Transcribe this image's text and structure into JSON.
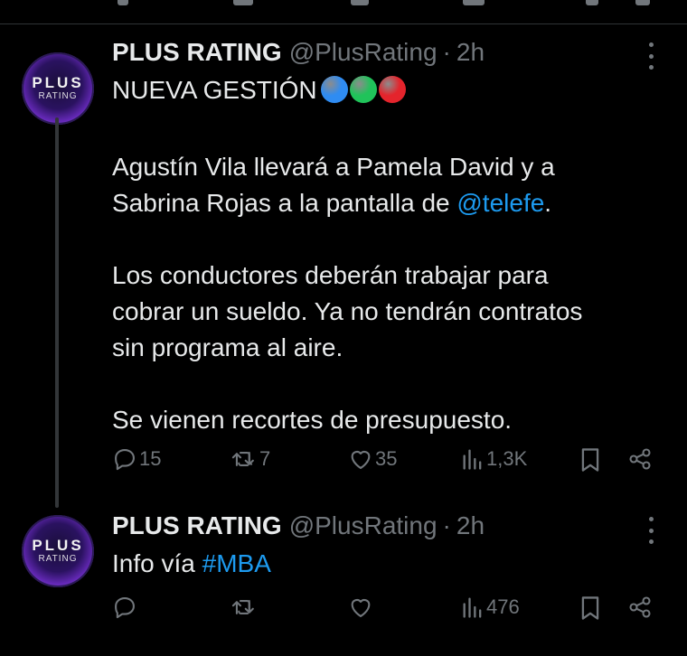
{
  "tweets": [
    {
      "avatar": {
        "line1": "PLUS",
        "line2": "RATING"
      },
      "name": "PLUS RATING",
      "handle": "@PlusRating",
      "separator": "·",
      "time": "2h",
      "text": {
        "line1": "NUEVA GESTIÓN",
        "line1_circle_colors": [
          "#2f8cf2",
          "#20c35a",
          "#e4242c"
        ],
        "p1_before": "Agustín Vila llevará a Pamela David y a",
        "p1_line2": "Sabrina Rojas a la pantalla de ",
        "p1_mention": "@telefe",
        "p1_after": ".",
        "p2_line1": "Los conductores deberán trabajar para",
        "p2_line2": "cobrar un sueldo. Ya no tendrán contratos",
        "p2_line3": "sin programa al aire.",
        "p3": "Se vienen recortes de presupuesto."
      },
      "actions": {
        "replies": "15",
        "retweets": "7",
        "likes": "35",
        "views": "1,3K"
      }
    },
    {
      "avatar": {
        "line1": "PLUS",
        "line2": "RATING"
      },
      "name": "PLUS RATING",
      "handle": "@PlusRating",
      "separator": "·",
      "time": "2h",
      "text": {
        "before": "Info vía ",
        "hashtag": "#MBA"
      },
      "actions": {
        "replies": "",
        "retweets": "",
        "likes": "",
        "views": "476"
      }
    }
  ],
  "colors": {
    "background": "#000000",
    "text": "#e7e9ea",
    "muted": "#71767b",
    "link": "#1d9bf0",
    "divider": "#2f3336"
  }
}
